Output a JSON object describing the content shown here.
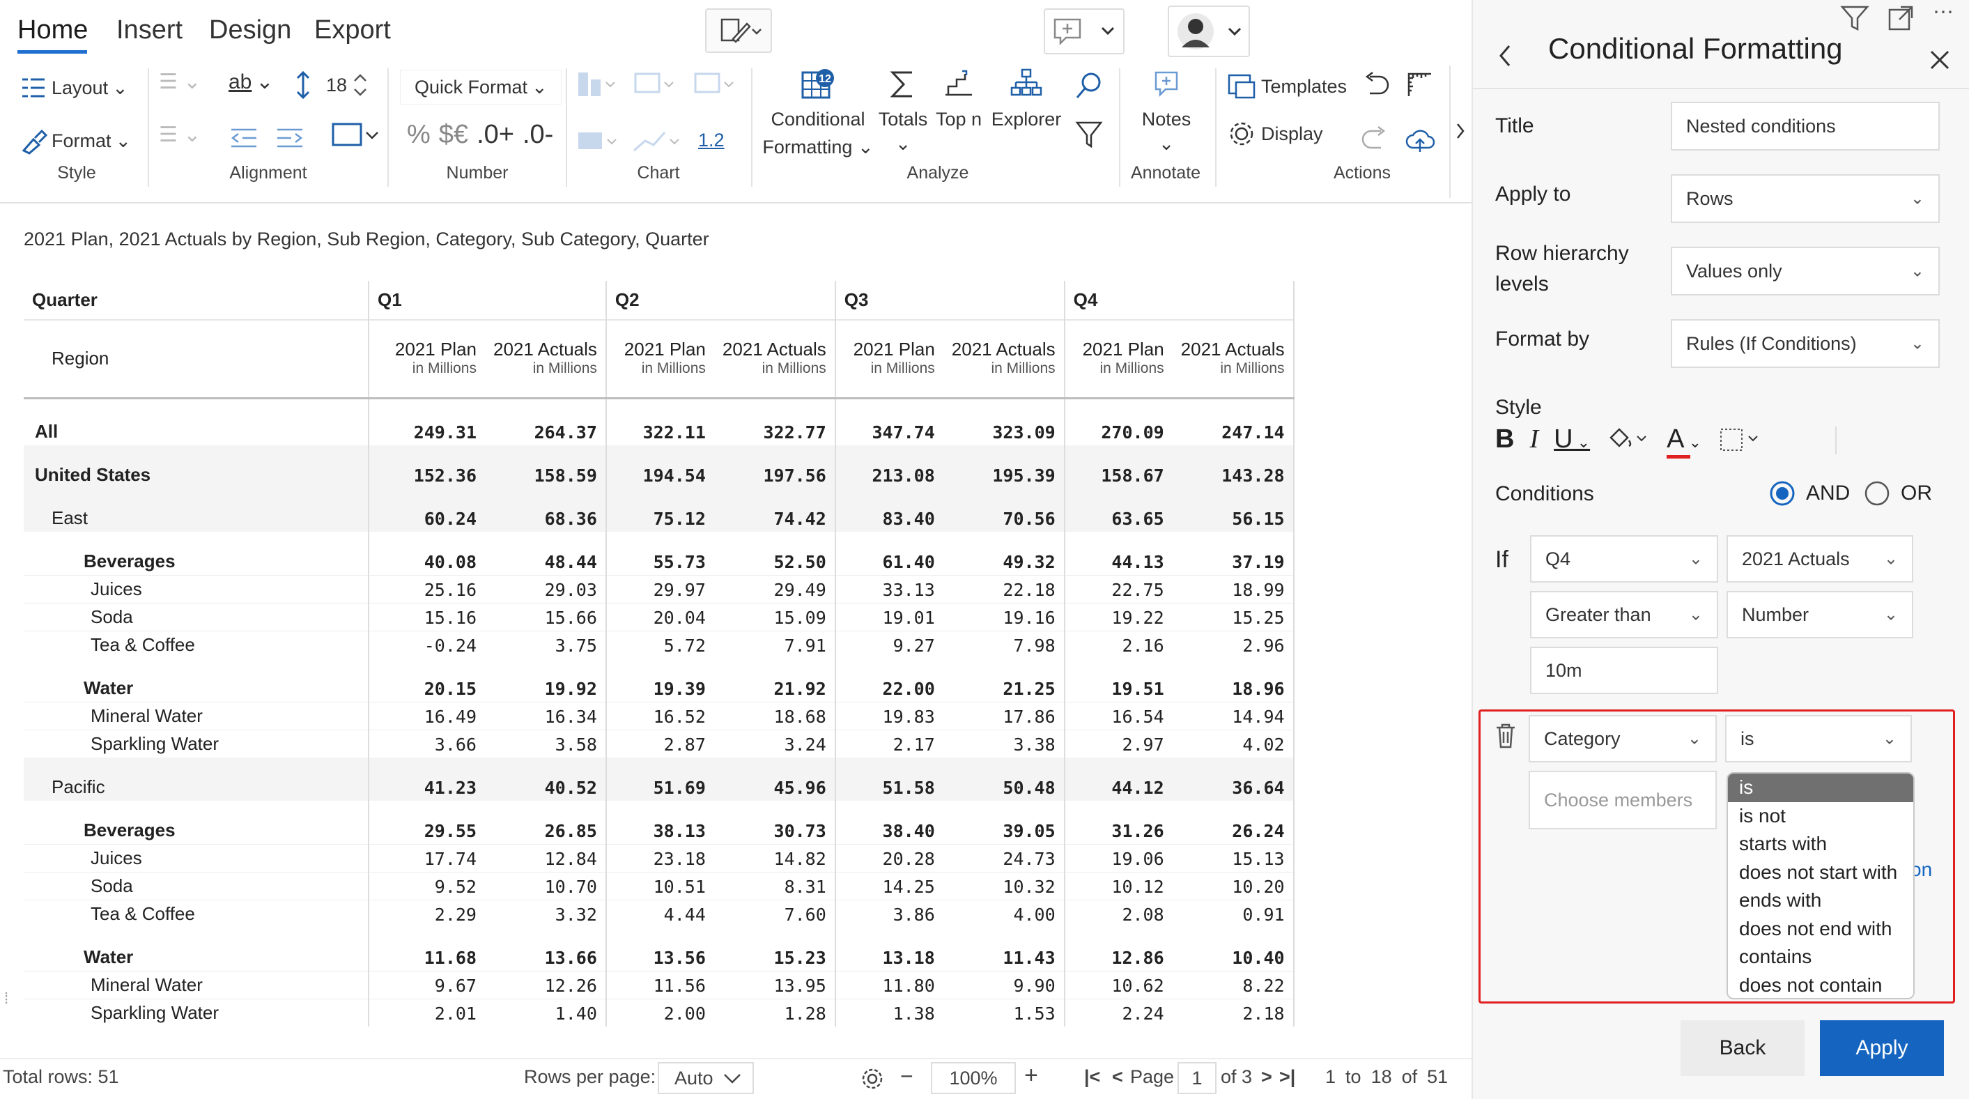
{
  "ribbon": {
    "tabs": [
      "Home",
      "Insert",
      "Design",
      "Export"
    ],
    "style": {
      "layout": "Layout",
      "format": "Format",
      "label": "Style"
    },
    "alignment": {
      "font_size": "18",
      "text_icon": "ab",
      "label": "Alignment"
    },
    "number": {
      "quick_format": "Quick Format",
      "percent": "%",
      "currency": "$€",
      "inc_dec": ".0+",
      "dec_dec": ".0-",
      "label": "Number"
    },
    "chart": {
      "scale": "1.2",
      "label": "Chart"
    },
    "analyze": {
      "conditional": "Conditional",
      "formatting": "Formatting",
      "totals": "Totals",
      "topn": "Top n",
      "explorer": "Explorer",
      "label": "Analyze"
    },
    "annotate": {
      "notes": "Notes",
      "label": "Annotate"
    },
    "actions": {
      "templates": "Templates",
      "display": "Display",
      "label": "Actions"
    }
  },
  "report": {
    "title": "2021 Plan, 2021 Actuals by Region, Sub Region, Category, Sub Category, Quarter",
    "header": {
      "quarter_label": "Quarter",
      "region_label": "Region",
      "quarters": [
        "Q1",
        "Q2",
        "Q3",
        "Q4"
      ],
      "measures": [
        "2021 Plan",
        "2021 Actuals",
        "2021 Plan",
        "2021 Actuals",
        "2021 Plan",
        "2021 Actuals",
        "2021 Plan",
        "2021 Actuals"
      ],
      "unit": "in Millions"
    },
    "rows": [
      {
        "name": "All",
        "level": 0,
        "bold": true,
        "gap": false,
        "values": [
          "249.31",
          "264.37",
          "322.11",
          "322.77",
          "347.74",
          "323.09",
          "270.09",
          "247.14"
        ]
      },
      {
        "name": "United States",
        "level": 0,
        "bold": true,
        "gap": true,
        "values": [
          "152.36",
          "158.59",
          "194.54",
          "197.56",
          "213.08",
          "195.39",
          "158.67",
          "143.28"
        ]
      },
      {
        "name": "East",
        "level": 1,
        "bold": false,
        "gap": true,
        "values": [
          "60.24",
          "68.36",
          "75.12",
          "74.42",
          "83.40",
          "70.56",
          "63.65",
          "56.15"
        ]
      },
      {
        "name": "Beverages",
        "level": 2,
        "bold": true,
        "gap": true,
        "values": [
          "40.08",
          "48.44",
          "55.73",
          "52.50",
          "61.40",
          "49.32",
          "44.13",
          "37.19"
        ]
      },
      {
        "name": "Juices",
        "level": 3,
        "bold": false,
        "gap": false,
        "values": [
          "25.16",
          "29.03",
          "29.97",
          "29.49",
          "33.13",
          "22.18",
          "22.75",
          "18.99"
        ]
      },
      {
        "name": "Soda",
        "level": 3,
        "bold": false,
        "gap": false,
        "values": [
          "15.16",
          "15.66",
          "20.04",
          "15.09",
          "19.01",
          "19.16",
          "19.22",
          "15.25"
        ]
      },
      {
        "name": "Tea & Coffee",
        "level": 3,
        "bold": false,
        "gap": false,
        "values": [
          "-0.24",
          "3.75",
          "5.72",
          "7.91",
          "9.27",
          "7.98",
          "2.16",
          "2.96"
        ]
      },
      {
        "name": "Water",
        "level": 2,
        "bold": true,
        "gap": true,
        "values": [
          "20.15",
          "19.92",
          "19.39",
          "21.92",
          "22.00",
          "21.25",
          "19.51",
          "18.96"
        ]
      },
      {
        "name": "Mineral Water",
        "level": 3,
        "bold": false,
        "gap": false,
        "values": [
          "16.49",
          "16.34",
          "16.52",
          "18.68",
          "19.83",
          "17.86",
          "16.54",
          "14.94"
        ]
      },
      {
        "name": "Sparkling Water",
        "level": 3,
        "bold": false,
        "gap": false,
        "values": [
          "3.66",
          "3.58",
          "2.87",
          "3.24",
          "2.17",
          "3.38",
          "2.97",
          "4.02"
        ]
      },
      {
        "name": "Pacific",
        "level": 1,
        "bold": false,
        "gap": true,
        "values": [
          "41.23",
          "40.52",
          "51.69",
          "45.96",
          "51.58",
          "50.48",
          "44.12",
          "36.64"
        ]
      },
      {
        "name": "Beverages",
        "level": 2,
        "bold": true,
        "gap": true,
        "values": [
          "29.55",
          "26.85",
          "38.13",
          "30.73",
          "38.40",
          "39.05",
          "31.26",
          "26.24"
        ]
      },
      {
        "name": "Juices",
        "level": 3,
        "bold": false,
        "gap": false,
        "values": [
          "17.74",
          "12.84",
          "23.18",
          "14.82",
          "20.28",
          "24.73",
          "19.06",
          "15.13"
        ]
      },
      {
        "name": "Soda",
        "level": 3,
        "bold": false,
        "gap": false,
        "values": [
          "9.52",
          "10.70",
          "10.51",
          "8.31",
          "14.25",
          "10.32",
          "10.12",
          "10.20"
        ]
      },
      {
        "name": "Tea & Coffee",
        "level": 3,
        "bold": false,
        "gap": false,
        "values": [
          "2.29",
          "3.32",
          "4.44",
          "7.60",
          "3.86",
          "4.00",
          "2.08",
          "0.91"
        ]
      },
      {
        "name": "Water",
        "level": 2,
        "bold": true,
        "gap": true,
        "values": [
          "11.68",
          "13.66",
          "13.56",
          "15.23",
          "13.18",
          "11.43",
          "12.86",
          "10.40"
        ]
      },
      {
        "name": "Mineral Water",
        "level": 3,
        "bold": false,
        "gap": false,
        "values": [
          "9.67",
          "12.26",
          "11.56",
          "13.95",
          "11.80",
          "9.90",
          "10.62",
          "8.22"
        ]
      },
      {
        "name": "Sparkling Water",
        "level": 3,
        "bold": false,
        "gap": false,
        "values": [
          "2.01",
          "1.40",
          "2.00",
          "1.28",
          "1.38",
          "1.53",
          "2.24",
          "2.18"
        ]
      }
    ]
  },
  "status_bar": {
    "total_rows": "Total rows: 51",
    "rows_per_page_label": "Rows per page:",
    "rows_per_page_value": "Auto",
    "zoom": "100%",
    "page_label": "Page",
    "page_value": "1",
    "page_of": "of 3",
    "range_from": "1",
    "range_to_label": "to",
    "range_to": "18",
    "range_of_label": "of",
    "range_total": "51"
  },
  "panel": {
    "title": "Conditional Formatting",
    "title_label": "Title",
    "title_value": "Nested conditions",
    "apply_to_label": "Apply to",
    "apply_to_value": "Rows",
    "row_hierarchy_label_1": "Row hierarchy",
    "row_hierarchy_label_2": "levels",
    "row_hierarchy_value": "Values only",
    "format_by_label": "Format by",
    "format_by_value": "Rules (If Conditions)",
    "style_label": "Style",
    "conditions_label": "Conditions",
    "and_label": "AND",
    "or_label": "OR",
    "if_label": "If",
    "cond1": {
      "field": "Q4",
      "measure": "2021 Actuals",
      "operator": "Greater than",
      "type": "Number",
      "value": "10m"
    },
    "cond2": {
      "field": "Category",
      "operator": "is",
      "members_placeholder": "Choose members"
    },
    "operator_options": [
      "is",
      "is not",
      "starts with",
      "does not start with",
      "ends with",
      "does not end with",
      "contains",
      "does not contain"
    ],
    "back_label": "Back",
    "apply_label": "Apply",
    "highlight_color": "#e02020",
    "accent_color": "#1565c0"
  }
}
